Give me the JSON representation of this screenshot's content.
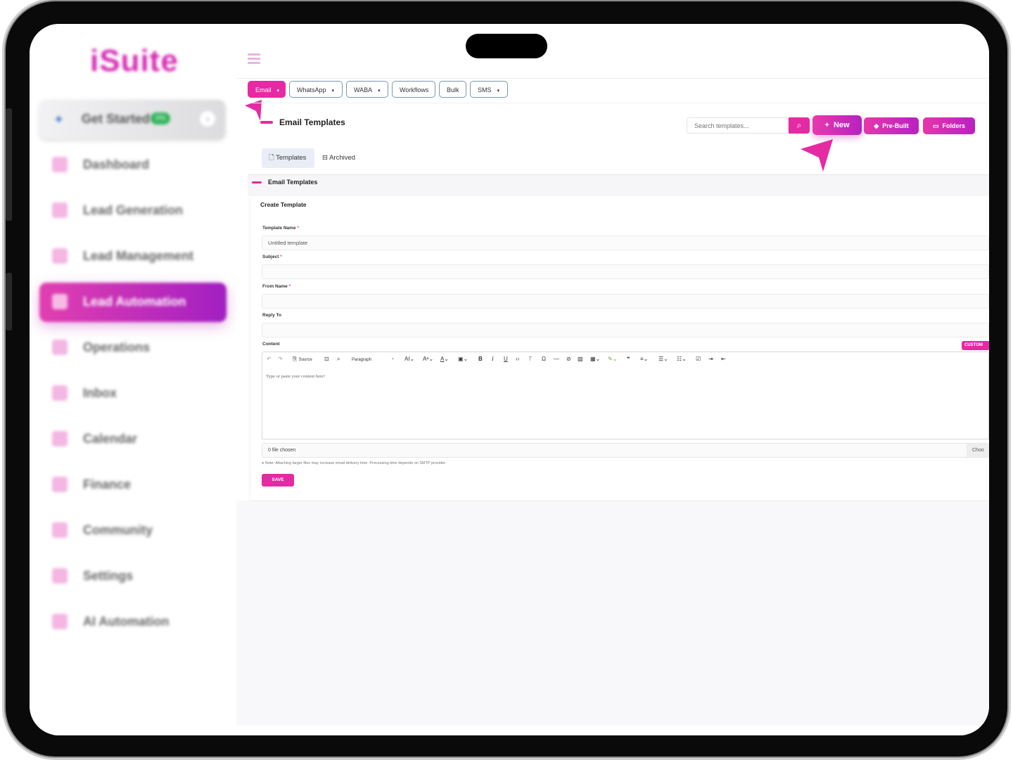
{
  "brand": {
    "logo_text": "iSuite",
    "accent": "#e52aa3",
    "accent_dark": "#b622c0"
  },
  "sidebar": {
    "get_started": {
      "label": "Get Started",
      "percent": "0%"
    },
    "items": [
      {
        "label": "Dashboard",
        "icon": "dashboard-icon"
      },
      {
        "label": "Lead Generation",
        "icon": "people-icon"
      },
      {
        "label": "Lead Management",
        "icon": "clipboard-icon"
      },
      {
        "label": "Lead Automation",
        "icon": "funnel-icon",
        "active": true
      },
      {
        "label": "Operations",
        "icon": "operations-icon"
      },
      {
        "label": "Inbox",
        "icon": "inbox-icon"
      },
      {
        "label": "Calendar",
        "icon": "calendar-icon"
      },
      {
        "label": "Finance",
        "icon": "finance-icon"
      },
      {
        "label": "Community",
        "icon": "community-icon"
      },
      {
        "label": "Settings",
        "icon": "settings-icon"
      },
      {
        "label": "AI Automation",
        "icon": "megaphone-icon"
      }
    ]
  },
  "channel_tabs": [
    {
      "label": "Email",
      "dropdown": true,
      "active": true
    },
    {
      "label": "WhatsApp",
      "dropdown": true
    },
    {
      "label": "WABA",
      "dropdown": true
    },
    {
      "label": "Workflows",
      "dropdown": false
    },
    {
      "label": "Bulk",
      "dropdown": false
    },
    {
      "label": "SMS",
      "dropdown": true
    }
  ],
  "header": {
    "title": "Email Templates",
    "search_placeholder": "Search templates...",
    "new_label": "New",
    "prebuilt_label": "Pre-Built",
    "folders_label": "Folders"
  },
  "subtabs": {
    "templates": "Templates",
    "archived": "Archived"
  },
  "section": {
    "title": "Email Templates"
  },
  "form": {
    "title": "Create Template",
    "template_name_label": "Template Name",
    "template_name_value": "Untitled template",
    "subject_label": "Subject",
    "from_name_label": "From Name",
    "reply_to_label": "Reply To",
    "content_label": "Content",
    "custom_button": "CUSTOM",
    "toolbar": {
      "source": "Source",
      "paragraph": "Paragraph"
    },
    "editor_placeholder": "Type or paste your content here!",
    "file_label": "0 file chosen",
    "choose_label": "Choo",
    "note": "Note: Attaching larger files may increase email delivery time. Processing time depends on SMTP provider.",
    "save_label": "SAVE"
  }
}
